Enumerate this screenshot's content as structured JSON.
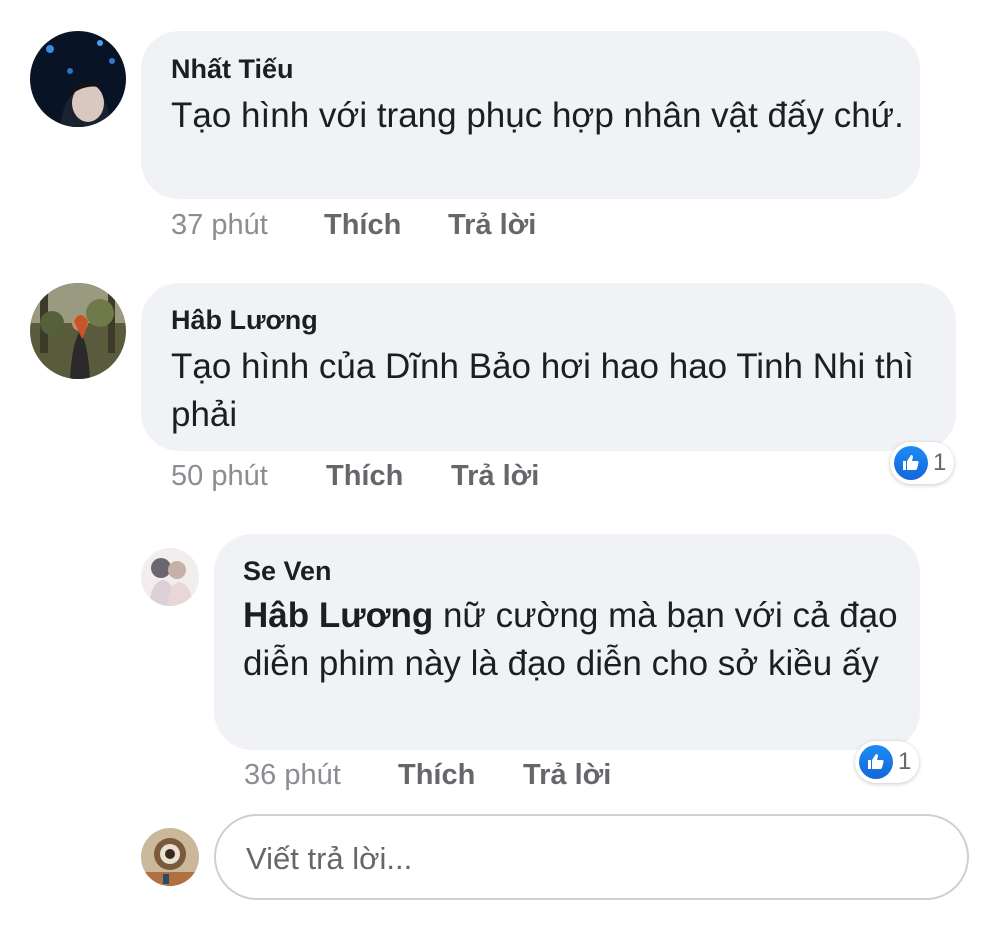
{
  "comments": [
    {
      "author": "Nhất Tiếu",
      "text": "Tạo hình với trang phục hợp nhân vật đấy chứ.",
      "time": "37 phút",
      "like_label": "Thích",
      "reply_label": "Trả lời"
    },
    {
      "author": "Hâb Lương",
      "text": "Tạo hình của Dĩnh Bảo hơi hao hao Tinh Nhi thì phải",
      "time": "50 phút",
      "like_label": "Thích",
      "reply_label": "Trả lời",
      "reaction_count": "1"
    }
  ],
  "reply": {
    "author": "Se Ven",
    "mention": "Hâb Lương",
    "text": " nữ cường mà bạn với cả đạo diễn phim này là đạo diễn cho sở kiều ấy",
    "time": "36 phút",
    "like_label": "Thích",
    "reply_label": "Trả lời",
    "reaction_count": "1"
  },
  "reply_box": {
    "placeholder": "Viết trả lời..."
  },
  "colors": {
    "bubble": "#f0f2f5",
    "like_blue": "#1877f2",
    "meta_gray": "#65676b"
  },
  "icons": {
    "reaction": "like-thumb-icon"
  }
}
